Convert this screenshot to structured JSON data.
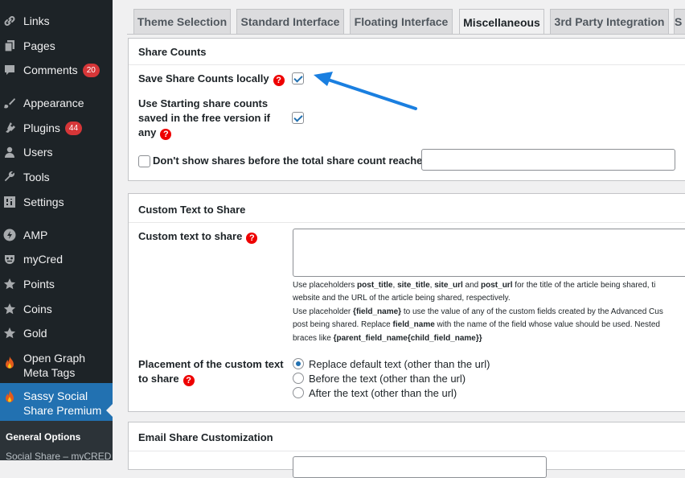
{
  "sidebar": {
    "items": [
      {
        "label": "Links",
        "icon": "link-icon"
      },
      {
        "label": "Pages",
        "icon": "pages-icon"
      },
      {
        "label": "Comments",
        "icon": "comments-icon",
        "badge": "20"
      },
      {
        "label": "Appearance",
        "icon": "brush-icon"
      },
      {
        "label": "Plugins",
        "icon": "plugin-icon",
        "badge": "44"
      },
      {
        "label": "Users",
        "icon": "user-icon"
      },
      {
        "label": "Tools",
        "icon": "wrench-icon"
      },
      {
        "label": "Settings",
        "icon": "settings-icon"
      },
      {
        "label": "AMP",
        "icon": "amp-icon"
      },
      {
        "label": "myCred",
        "icon": "mycred-icon"
      },
      {
        "label": "Points",
        "icon": "star-icon"
      },
      {
        "label": "Coins",
        "icon": "star-icon"
      },
      {
        "label": "Gold",
        "icon": "star-icon"
      },
      {
        "label": "Open Graph Meta Tags",
        "icon": "flame-icon"
      },
      {
        "label": "Sassy Social Share Premium",
        "icon": "flame-icon"
      }
    ],
    "submenu": {
      "current": "General Options",
      "next": "Social Share – myCRED"
    }
  },
  "tabs": [
    "Theme Selection",
    "Standard Interface",
    "Floating Interface",
    "Miscellaneous",
    "3rd Party Integration",
    "S"
  ],
  "active_tab": "Miscellaneous",
  "share_counts": {
    "heading": "Share Counts",
    "save_locally_label": "Save Share Counts locally",
    "save_locally_checked": true,
    "starting_counts_label_1": "Use Starting share counts",
    "starting_counts_label_2": "saved in the free version if",
    "starting_counts_label_3": "any",
    "starting_counts_checked": true,
    "dont_show_label": "Don't show shares before the total share count reaches",
    "dont_show_checked": false,
    "threshold_value": ""
  },
  "custom_text": {
    "heading": "Custom Text to Share",
    "custom_text_label": "Custom text to share",
    "custom_text_value": "",
    "hint": {
      "l1_a": "Use placeholders ",
      "l1_b1": "post_title",
      "l1_c": ", ",
      "l1_b2": "site_title",
      "l1_d": ", ",
      "l1_b3": "site_url",
      "l1_e": " and ",
      "l1_b4": "post_url",
      "l1_f": " for the title of the article being shared, ti",
      "l2": "website and the URL of the article being shared, respectively.",
      "l3_a": "Use placeholder ",
      "l3_b": "{field_name}",
      "l3_c": " to use the value of any of the custom fields created by the Advanced Cus",
      "l4_a": "post being shared. Replace ",
      "l4_b": "field_name",
      "l4_c": " with the name of the field whose value should be used. Nested",
      "l5_a": "braces like ",
      "l5_b": "{parent_field_name{child_field_name}}"
    },
    "placement_label_1": "Placement of the custom text",
    "placement_label_2": "to share",
    "placement_options": [
      "Replace default text (other than the url)",
      "Before the text (other than the url)",
      "After the text (other than the url)"
    ],
    "placement_selected": "Replace default text (other than the url)"
  },
  "email_share": {
    "heading": "Email Share Customization"
  },
  "colors": {
    "sidebar_bg": "#1d2327",
    "active_menu": "#2271b1",
    "help_icon": "#ee0000",
    "annotation_arrow": "#1a7fe0"
  }
}
